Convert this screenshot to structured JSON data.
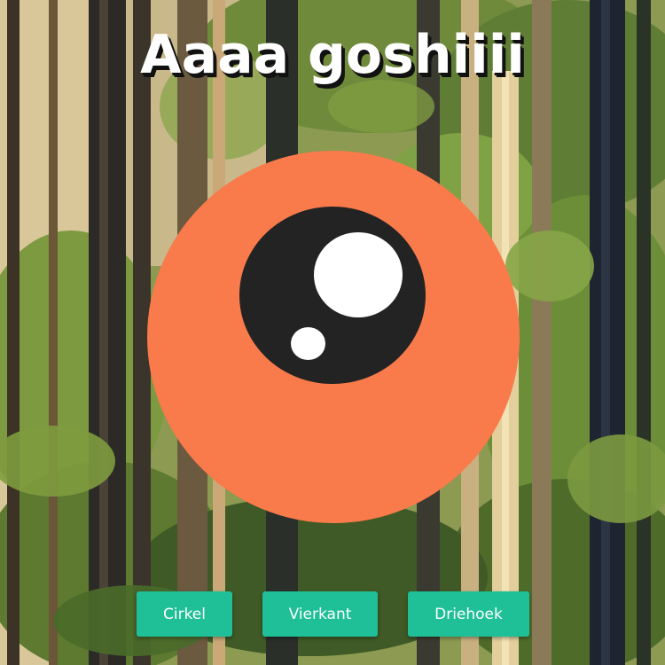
{
  "title": "Aaaa goshiiii",
  "buttons": {
    "cirkel": "Cirkel",
    "vierkant": "Vierkant",
    "driehoek": "Driehoek"
  },
  "colors": {
    "eye": "#f97a4a",
    "iris": "#232323",
    "highlight": "#ffffff",
    "button": "#1fbf98"
  },
  "background": {
    "name": "forest-background-image"
  }
}
